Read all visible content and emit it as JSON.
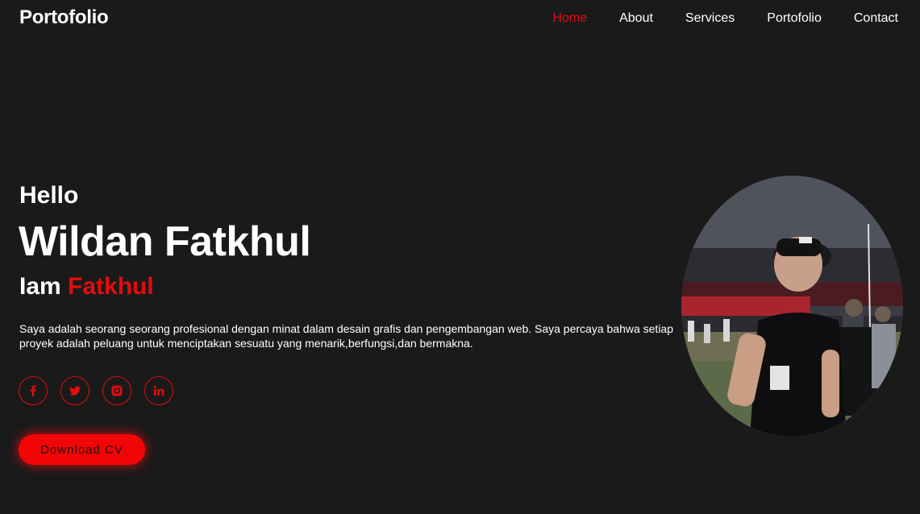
{
  "header": {
    "logo": "Portofolio",
    "nav": [
      {
        "label": "Home",
        "active": true
      },
      {
        "label": "About",
        "active": false
      },
      {
        "label": "Services",
        "active": false
      },
      {
        "label": "Portofolio",
        "active": false
      },
      {
        "label": "Contact",
        "active": false
      }
    ]
  },
  "hero": {
    "greeting": "Hello",
    "name": "Wildan Fatkhul",
    "iam_prefix": "Iam",
    "iam_accent": "Fatkhul",
    "description": "Saya adalah seorang seorang profesional dengan minat dalam desain grafis dan pengembangan web. Saya percaya bahwa setiap proyek adalah peluang untuk menciptakan sesuatu yang menarik,berfungsi,dan bermakna.",
    "socials": [
      "facebook-icon",
      "twitter-icon",
      "instagram-icon",
      "linkedin-icon"
    ],
    "cv_button": "Download CV"
  },
  "colors": {
    "background": "#1a1a1b",
    "accent": "#e10d0d",
    "text": "#ffffff"
  }
}
